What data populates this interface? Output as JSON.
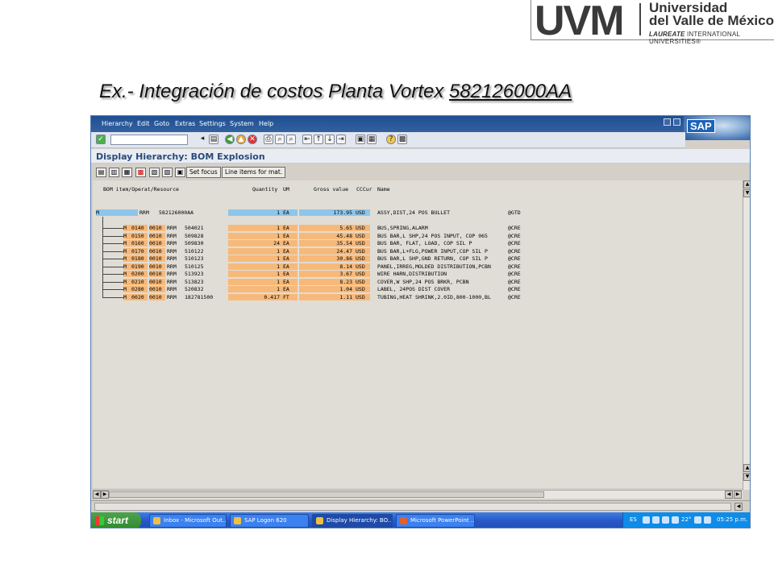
{
  "logo": {
    "short": "UVM",
    "line1": "Universidad",
    "line2": "del Valle de México",
    "line3_bold": "LAUREATE",
    "line3_rest": " INTERNATIONAL UNIVERSITIES®"
  },
  "slide_title": {
    "prefix": "Ex.- Integración de costos Planta Vortex ",
    "code": "582126000AA"
  },
  "sap": {
    "menu": [
      "Hierarchy",
      "Edit",
      "Goto",
      "Extras",
      "Settings",
      "System",
      "Help"
    ],
    "sap_logo": "SAP",
    "screen_title": "Display Hierarchy: BOM Explosion",
    "toolbar2_buttons": [
      "Set focus",
      "Line items for mat."
    ],
    "columns": {
      "item": "BOM item/Operat/Resource",
      "quantity": "Quantity",
      "um": "UM",
      "gross": "Gross value",
      "ccur": "CCCur",
      "name": "Name"
    },
    "root": {
      "type": "M",
      "rrm": "RRM",
      "material": "582126000AA",
      "quantity": "1",
      "um": "EA",
      "gross": "173.95",
      "cur": "USD",
      "name": "ASSY,DIST,24 POS BULLET",
      "flag": "@GTD"
    },
    "rows": [
      {
        "type": "M",
        "item": "0140",
        "op": "0010",
        "rrm": "RRM",
        "material": "504021",
        "quantity": "1",
        "um": "EA",
        "gross": "5.65",
        "cur": "USD",
        "name": "BUS,SPRING,ALARM",
        "flag": "@CRE"
      },
      {
        "type": "M",
        "item": "0150",
        "op": "0010",
        "rrm": "RRM",
        "material": "509828",
        "quantity": "1",
        "um": "EA",
        "gross": "45.48",
        "cur": "USD",
        "name": "BUS BAR,L SHP,24 POS INPUT, COP 065",
        "flag": "@CRE"
      },
      {
        "type": "M",
        "item": "0160",
        "op": "0010",
        "rrm": "RRM",
        "material": "509830",
        "quantity": "24",
        "um": "EA",
        "gross": "35.54",
        "cur": "USD",
        "name": "BUS BAR, FLAT, LOAD, COP SIL P",
        "flag": "@CRE"
      },
      {
        "type": "M",
        "item": "0170",
        "op": "0010",
        "rrm": "RRM",
        "material": "510122",
        "quantity": "1",
        "um": "EA",
        "gross": "24.47",
        "cur": "USD",
        "name": "BUS BAR,L+FLG,POWER INPUT,COP SIL P",
        "flag": "@CRE"
      },
      {
        "type": "M",
        "item": "0180",
        "op": "0010",
        "rrm": "RRM",
        "material": "510123",
        "quantity": "1",
        "um": "EA",
        "gross": "30.86",
        "cur": "USD",
        "name": "BUS BAR,L SHP,GND RETURN, COP SIL P",
        "flag": "@CRE"
      },
      {
        "type": "M",
        "item": "0190",
        "op": "0010",
        "rrm": "RRM",
        "material": "510125",
        "quantity": "1",
        "um": "EA",
        "gross": "8.14",
        "cur": "USD",
        "name": "PANEL,IRREG,MOLDED DISTRIBUTION,PCBN",
        "flag": "@CRE"
      },
      {
        "type": "M",
        "item": "0200",
        "op": "0010",
        "rrm": "RRM",
        "material": "513923",
        "quantity": "1",
        "um": "EA",
        "gross": "3.67",
        "cur": "USD",
        "name": "WIRE HARN,DISTRIBUTION",
        "flag": "@CRE"
      },
      {
        "type": "M",
        "item": "0210",
        "op": "0010",
        "rrm": "RRM",
        "material": "513823",
        "quantity": "1",
        "um": "EA",
        "gross": "8.23",
        "cur": "USD",
        "name": "COVER,W SHP,24 POS BRKR, PCBN",
        "flag": "@CRE"
      },
      {
        "type": "M",
        "item": "0280",
        "op": "0010",
        "rrm": "RRM",
        "material": "520832",
        "quantity": "1",
        "um": "EA",
        "gross": "1.04",
        "cur": "USD",
        "name": "LABEL, 24POS DIST COVER",
        "flag": "@CRE"
      },
      {
        "type": "M",
        "item": "0020",
        "op": "0010",
        "rrm": "RRM",
        "material": "182781500",
        "quantity": "0.417",
        "um": "FT",
        "gross": "1.11",
        "cur": "USD",
        "name": "TUBING,HEAT SHRINK,2.0ID,800-1000,BL",
        "flag": "@CRE"
      }
    ]
  },
  "taskbar": {
    "start": "start",
    "tasks": [
      "Inbox - Microsoft Out...",
      "SAP Logon 620",
      "Display Hierarchy: BO...",
      "Microsoft PowerPoint ..."
    ],
    "lang": "ES",
    "temp": "22°",
    "time": "05:25 p.m."
  },
  "colors": {
    "orange_highlight": "#f7b97a",
    "blue_highlight": "#8ec5ea",
    "title_bar": "#1e4f93"
  }
}
